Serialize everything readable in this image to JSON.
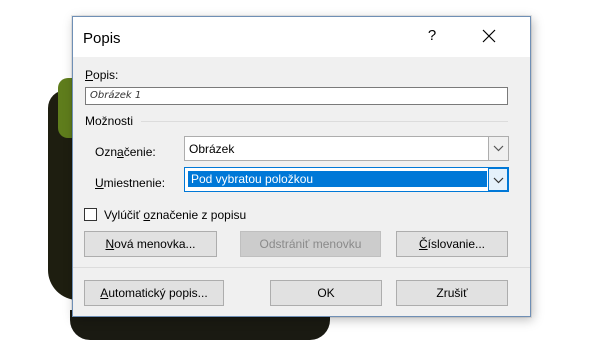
{
  "dialog": {
    "title": "Popis",
    "help_label": "?",
    "caption_label_first": "P",
    "caption_label_rest": "opis:",
    "caption_value": "Obrázek 1",
    "options_label": "Možnosti",
    "label_field": {
      "label_pre": "Ozn",
      "label_key": "a",
      "label_post": "čenie:",
      "value": "Obrázek"
    },
    "position_field": {
      "label_key": "U",
      "label_rest": "miestnenie:",
      "value": "Pod vybratou položkou"
    },
    "exclude_label": {
      "pre": "Vylúčiť ",
      "key": "o",
      "post": "značenie z popisu"
    },
    "buttons": {
      "new_label": {
        "key": "N",
        "rest": "ová menovka..."
      },
      "delete_label": {
        "text": "Odstrániť menovku"
      },
      "numbering": {
        "key": "Č",
        "rest": "íslovanie..."
      },
      "autocaption": {
        "key": "A",
        "rest": "utomatický popis..."
      },
      "ok": "OK",
      "cancel": "Zrušiť"
    }
  },
  "colors": {
    "accent": "#0078d7",
    "dialog_bg": "#f0f0f0",
    "titlebar_bg": "#ffffff"
  }
}
